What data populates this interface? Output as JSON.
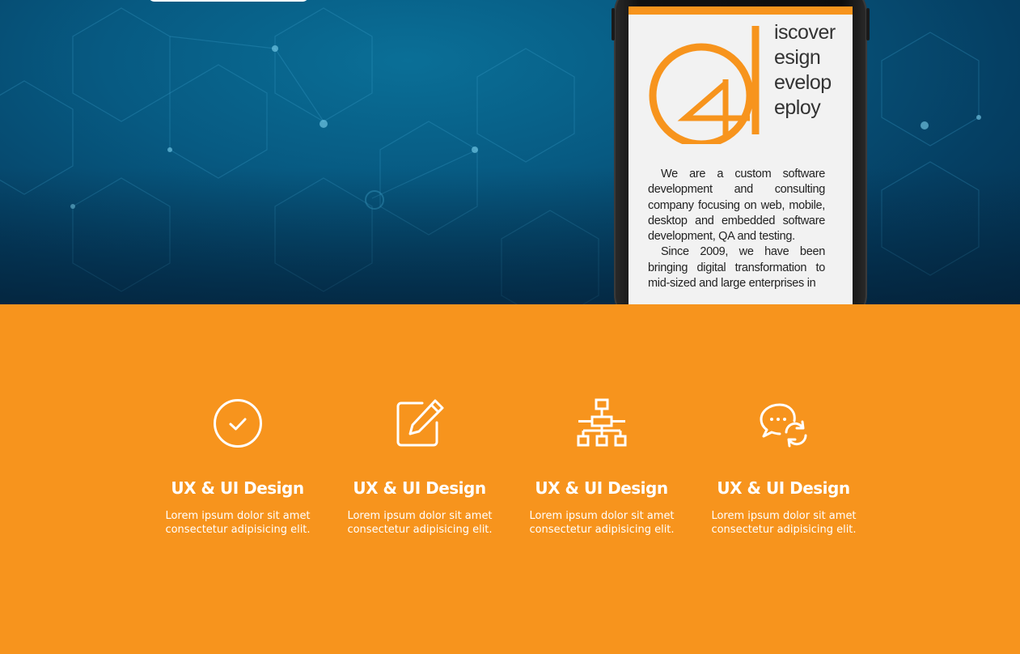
{
  "hero": {
    "phone_screen": {
      "logo_words": [
        "iscover",
        "esign",
        "evelop",
        "eploy"
      ],
      "logo_digit": "4",
      "paragraph_1": "We are a custom software development and consulting company focusing on web, mobile, desktop and embedded software development, QA and testing.",
      "paragraph_2": "Since 2009, we have been bringing digital transformation to mid-sized and large enterprises in"
    }
  },
  "features": {
    "background_color": "#f7941d",
    "items": [
      {
        "icon": "check-circle-icon",
        "title": "UX & UI Design",
        "text": "Lorem ipsum dolor sit amet consectetur adipisicing elit."
      },
      {
        "icon": "edit-icon",
        "title": "UX & UI Design",
        "text": "Lorem ipsum dolor sit amet consectetur adipisicing elit."
      },
      {
        "icon": "sitemap-icon",
        "title": "UX & UI Design",
        "text": "Lorem ipsum dolor sit amet consectetur adipisicing elit."
      },
      {
        "icon": "chat-refresh-icon",
        "title": "UX & UI Design",
        "text": "Lorem ipsum dolor sit amet consectetur adipisicing elit."
      }
    ]
  },
  "colors": {
    "accent": "#f7941d",
    "hero_dark": "#053f63",
    "hero_light": "#0a6f97"
  }
}
